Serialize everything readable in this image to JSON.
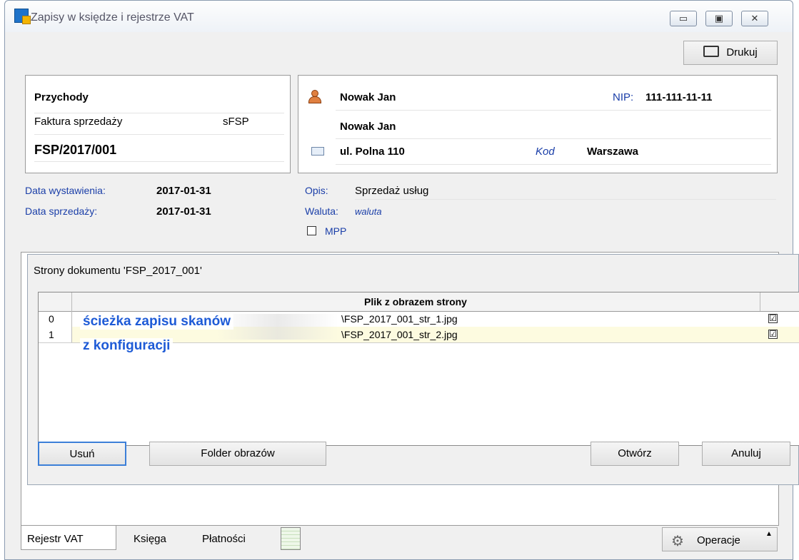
{
  "window": {
    "title": "Zapisy w księdze i rejestrze VAT",
    "minimize": "▭",
    "maximize": "▣",
    "close": "✕"
  },
  "toolbar": {
    "print_label": "Drukuj"
  },
  "document": {
    "section": "Przychody",
    "type": "Faktura sprzedaży",
    "code": "sFSP",
    "number": "FSP/2017/001"
  },
  "contractor": {
    "name": "Nowak Jan",
    "name2": "Nowak Jan",
    "nip_label": "NIP:",
    "nip": "111-111-11-11",
    "street": "ul. Polna 110",
    "kod_label": "Kod",
    "city": "Warszawa"
  },
  "dates": {
    "issue_label": "Data wystawienia:",
    "issue_value": "2017-01-31",
    "sale_label": "Data sprzedaży:",
    "sale_value": "2017-01-31"
  },
  "details": {
    "desc_label": "Opis:",
    "desc_value": "Sprzedaż usług",
    "currency_label": "Waluta:",
    "currency_value": "waluta",
    "mpp_label": "MPP"
  },
  "dialog": {
    "title": "Strony dokumentu 'FSP_2017_001'",
    "column_header": "Plik z obrazem strony",
    "rows": [
      {
        "index": "0",
        "file": "\\FSP_2017_001_str_1.jpg",
        "checked": "☑"
      },
      {
        "index": "1",
        "file": "\\FSP_2017_001_str_2.jpg",
        "checked": "☑"
      }
    ],
    "overlay_line1": "ścieżka zapisu skanów",
    "overlay_line2": "z konfiguracji",
    "buttons": {
      "delete": "Usuń",
      "folder": "Folder obrazów",
      "open": "Otwórz",
      "cancel": "Anuluj"
    }
  },
  "tabs": [
    "Rejestr VAT",
    "Księga",
    "Płatności"
  ],
  "operations_label": "Operacje",
  "colors": {
    "highlight_row": "#fdfbe0",
    "annotation": "#1e5bd6",
    "label_blue": "#1a3ea8"
  }
}
